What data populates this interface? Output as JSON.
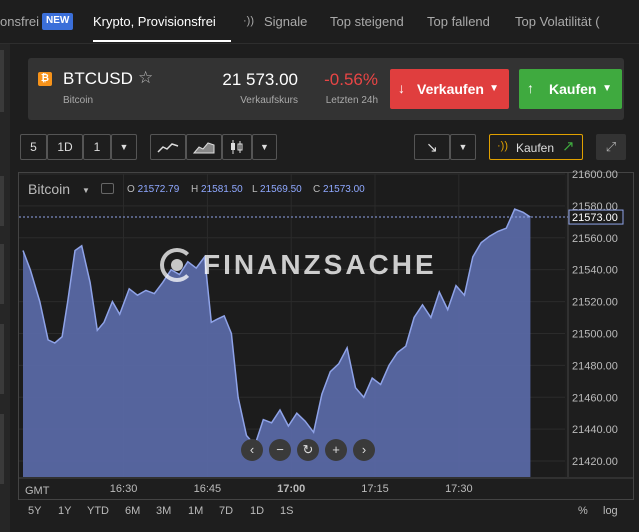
{
  "tabs": [
    {
      "label": "onsfrei",
      "active": false
    },
    {
      "label": "Krypto, Provisionsfrei",
      "active": true
    },
    {
      "label": "Signale",
      "active": false
    },
    {
      "label": "Top steigend",
      "active": false
    },
    {
      "label": "Top fallend",
      "active": false
    },
    {
      "label": "Top Volatilität (",
      "active": false
    }
  ],
  "new_badge": "NEW",
  "instrument": {
    "symbol": "BTCUSD",
    "name": "Bitcoin",
    "icon": "bitcoin-icon",
    "price": "21 573.00",
    "price_label": "Verkaufskurs",
    "change": "-0.56%",
    "change_label": "Letzten 24h"
  },
  "actions": {
    "sell_label": "Verkaufen",
    "buy_label": "Kaufen"
  },
  "toolbar": {
    "period": "5",
    "interval": "1D",
    "count": "1",
    "kaufen_label": "Kaufen"
  },
  "chart_header": {
    "series": "Bitcoin",
    "o_label": "O",
    "o": "21572.79",
    "h_label": "H",
    "h": "21581.50",
    "l_label": "L",
    "l": "21569.50",
    "c_label": "C",
    "c": "21573.00"
  },
  "watermark": "FINANZSACHE",
  "colors": {
    "accent_sell": "#e03e3e",
    "accent_buy": "#3faa3f",
    "area_fill": "#5a6aa8",
    "line": "#8fa3e8"
  },
  "chart_data": {
    "type": "area",
    "title": "",
    "series_name": "Bitcoin",
    "current_price_label": "21573.00",
    "timezone_label": "GMT",
    "x_ticks": [
      "16:30",
      "16:45",
      "17:00",
      "17:15",
      "17:30"
    ],
    "x_tick_minutes": [
      30,
      45,
      60,
      75,
      90
    ],
    "x_range_minutes": [
      12,
      109
    ],
    "y_ticks": [
      "21600.00",
      "21580.00",
      "21560.00",
      "21540.00",
      "21520.00",
      "21500.00",
      "21480.00",
      "21460.00",
      "21440.00",
      "21420.00"
    ],
    "ylim": [
      21410,
      21600
    ],
    "grid": true,
    "x_minutes": [
      12,
      13.3,
      15,
      16.5,
      17.7,
      19,
      20,
      21.3,
      22.5,
      24,
      25.3,
      26.5,
      28,
      29.3,
      31,
      32.5,
      34,
      35.5,
      37,
      38.5,
      40,
      41.5,
      43,
      44.5,
      45.7,
      46.8,
      48,
      49.3,
      50.5,
      52,
      53.5,
      55,
      56.5,
      58,
      59.5,
      61,
      62.5,
      64,
      65.5,
      67,
      68.5,
      70,
      71.5,
      73,
      74.5,
      76,
      77.5,
      79,
      80.5,
      82,
      83.5,
      85,
      86.5,
      88,
      89.5,
      91,
      92.5,
      94,
      95.5,
      97,
      98.5,
      100,
      101.5,
      102.8
    ],
    "values": [
      21552,
      21540,
      21520,
      21496,
      21494,
      21498,
      21520,
      21552,
      21555,
      21532,
      21502,
      21507,
      21520,
      21512,
      21528,
      21524,
      21527,
      21525,
      21532,
      21540,
      21537,
      21545,
      21541,
      21548,
      21507,
      21509,
      21511,
      21500,
      21460,
      21436,
      21430,
      21446,
      21444,
      21452,
      21442,
      21450,
      21445,
      21438,
      21462,
      21476,
      21481,
      21491,
      21466,
      21460,
      21472,
      21468,
      21480,
      21488,
      21492,
      21510,
      21518,
      21510,
      21526,
      21515,
      21530,
      21524,
      21548,
      21557,
      21561,
      21564,
      21566,
      21578,
      21576,
      21573
    ]
  },
  "chart_controls": {
    "prev_icon": "chevron-left-icon",
    "zoom_out_icon": "minus-icon",
    "reset_icon": "reset-icon",
    "zoom_in_icon": "plus-icon",
    "next_icon": "chevron-right-icon"
  },
  "ranges": [
    "5Y",
    "1Y",
    "YTD",
    "6M",
    "3M",
    "1M",
    "7D",
    "1D",
    "1S"
  ],
  "scale_options": [
    "%",
    "log"
  ]
}
